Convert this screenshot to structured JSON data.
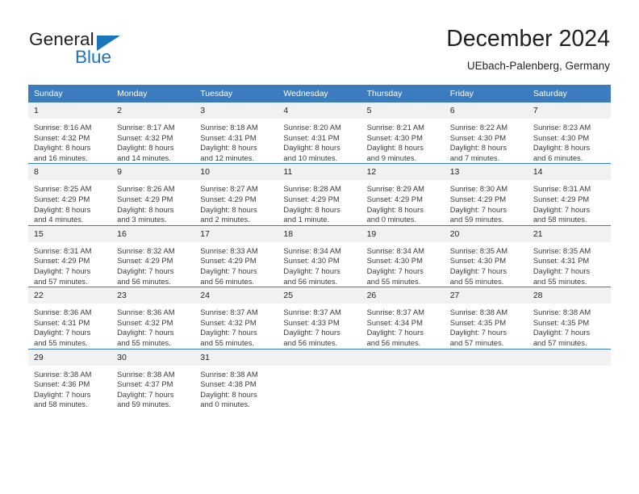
{
  "branding": {
    "name_part1": "General",
    "name_part2": "Blue",
    "primary_color": "#1b75bb",
    "header_color": "#3a7cbe"
  },
  "header": {
    "title": "December 2024",
    "subtitle": "UEbach-Palenberg, Germany"
  },
  "weekday_headers": [
    "Sunday",
    "Monday",
    "Tuesday",
    "Wednesday",
    "Thursday",
    "Friday",
    "Saturday"
  ],
  "labels": {
    "sunrise_prefix": "Sunrise:",
    "sunset_prefix": "Sunset:",
    "daylight_prefix": "Daylight:"
  },
  "weeks": [
    [
      {
        "day": "1",
        "sunrise": "Sunrise: 8:16 AM",
        "sunset": "Sunset: 4:32 PM",
        "daylight_line1": "Daylight: 8 hours",
        "daylight_line2": "and 16 minutes."
      },
      {
        "day": "2",
        "sunrise": "Sunrise: 8:17 AM",
        "sunset": "Sunset: 4:32 PM",
        "daylight_line1": "Daylight: 8 hours",
        "daylight_line2": "and 14 minutes."
      },
      {
        "day": "3",
        "sunrise": "Sunrise: 8:18 AM",
        "sunset": "Sunset: 4:31 PM",
        "daylight_line1": "Daylight: 8 hours",
        "daylight_line2": "and 12 minutes."
      },
      {
        "day": "4",
        "sunrise": "Sunrise: 8:20 AM",
        "sunset": "Sunset: 4:31 PM",
        "daylight_line1": "Daylight: 8 hours",
        "daylight_line2": "and 10 minutes."
      },
      {
        "day": "5",
        "sunrise": "Sunrise: 8:21 AM",
        "sunset": "Sunset: 4:30 PM",
        "daylight_line1": "Daylight: 8 hours",
        "daylight_line2": "and 9 minutes."
      },
      {
        "day": "6",
        "sunrise": "Sunrise: 8:22 AM",
        "sunset": "Sunset: 4:30 PM",
        "daylight_line1": "Daylight: 8 hours",
        "daylight_line2": "and 7 minutes."
      },
      {
        "day": "7",
        "sunrise": "Sunrise: 8:23 AM",
        "sunset": "Sunset: 4:30 PM",
        "daylight_line1": "Daylight: 8 hours",
        "daylight_line2": "and 6 minutes."
      }
    ],
    [
      {
        "day": "8",
        "sunrise": "Sunrise: 8:25 AM",
        "sunset": "Sunset: 4:29 PM",
        "daylight_line1": "Daylight: 8 hours",
        "daylight_line2": "and 4 minutes."
      },
      {
        "day": "9",
        "sunrise": "Sunrise: 8:26 AM",
        "sunset": "Sunset: 4:29 PM",
        "daylight_line1": "Daylight: 8 hours",
        "daylight_line2": "and 3 minutes."
      },
      {
        "day": "10",
        "sunrise": "Sunrise: 8:27 AM",
        "sunset": "Sunset: 4:29 PM",
        "daylight_line1": "Daylight: 8 hours",
        "daylight_line2": "and 2 minutes."
      },
      {
        "day": "11",
        "sunrise": "Sunrise: 8:28 AM",
        "sunset": "Sunset: 4:29 PM",
        "daylight_line1": "Daylight: 8 hours",
        "daylight_line2": "and 1 minute."
      },
      {
        "day": "12",
        "sunrise": "Sunrise: 8:29 AM",
        "sunset": "Sunset: 4:29 PM",
        "daylight_line1": "Daylight: 8 hours",
        "daylight_line2": "and 0 minutes."
      },
      {
        "day": "13",
        "sunrise": "Sunrise: 8:30 AM",
        "sunset": "Sunset: 4:29 PM",
        "daylight_line1": "Daylight: 7 hours",
        "daylight_line2": "and 59 minutes."
      },
      {
        "day": "14",
        "sunrise": "Sunrise: 8:31 AM",
        "sunset": "Sunset: 4:29 PM",
        "daylight_line1": "Daylight: 7 hours",
        "daylight_line2": "and 58 minutes."
      }
    ],
    [
      {
        "day": "15",
        "sunrise": "Sunrise: 8:31 AM",
        "sunset": "Sunset: 4:29 PM",
        "daylight_line1": "Daylight: 7 hours",
        "daylight_line2": "and 57 minutes."
      },
      {
        "day": "16",
        "sunrise": "Sunrise: 8:32 AM",
        "sunset": "Sunset: 4:29 PM",
        "daylight_line1": "Daylight: 7 hours",
        "daylight_line2": "and 56 minutes."
      },
      {
        "day": "17",
        "sunrise": "Sunrise: 8:33 AM",
        "sunset": "Sunset: 4:29 PM",
        "daylight_line1": "Daylight: 7 hours",
        "daylight_line2": "and 56 minutes."
      },
      {
        "day": "18",
        "sunrise": "Sunrise: 8:34 AM",
        "sunset": "Sunset: 4:30 PM",
        "daylight_line1": "Daylight: 7 hours",
        "daylight_line2": "and 56 minutes."
      },
      {
        "day": "19",
        "sunrise": "Sunrise: 8:34 AM",
        "sunset": "Sunset: 4:30 PM",
        "daylight_line1": "Daylight: 7 hours",
        "daylight_line2": "and 55 minutes."
      },
      {
        "day": "20",
        "sunrise": "Sunrise: 8:35 AM",
        "sunset": "Sunset: 4:30 PM",
        "daylight_line1": "Daylight: 7 hours",
        "daylight_line2": "and 55 minutes."
      },
      {
        "day": "21",
        "sunrise": "Sunrise: 8:35 AM",
        "sunset": "Sunset: 4:31 PM",
        "daylight_line1": "Daylight: 7 hours",
        "daylight_line2": "and 55 minutes."
      }
    ],
    [
      {
        "day": "22",
        "sunrise": "Sunrise: 8:36 AM",
        "sunset": "Sunset: 4:31 PM",
        "daylight_line1": "Daylight: 7 hours",
        "daylight_line2": "and 55 minutes."
      },
      {
        "day": "23",
        "sunrise": "Sunrise: 8:36 AM",
        "sunset": "Sunset: 4:32 PM",
        "daylight_line1": "Daylight: 7 hours",
        "daylight_line2": "and 55 minutes."
      },
      {
        "day": "24",
        "sunrise": "Sunrise: 8:37 AM",
        "sunset": "Sunset: 4:32 PM",
        "daylight_line1": "Daylight: 7 hours",
        "daylight_line2": "and 55 minutes."
      },
      {
        "day": "25",
        "sunrise": "Sunrise: 8:37 AM",
        "sunset": "Sunset: 4:33 PM",
        "daylight_line1": "Daylight: 7 hours",
        "daylight_line2": "and 56 minutes."
      },
      {
        "day": "26",
        "sunrise": "Sunrise: 8:37 AM",
        "sunset": "Sunset: 4:34 PM",
        "daylight_line1": "Daylight: 7 hours",
        "daylight_line2": "and 56 minutes."
      },
      {
        "day": "27",
        "sunrise": "Sunrise: 8:38 AM",
        "sunset": "Sunset: 4:35 PM",
        "daylight_line1": "Daylight: 7 hours",
        "daylight_line2": "and 57 minutes."
      },
      {
        "day": "28",
        "sunrise": "Sunrise: 8:38 AM",
        "sunset": "Sunset: 4:35 PM",
        "daylight_line1": "Daylight: 7 hours",
        "daylight_line2": "and 57 minutes."
      }
    ],
    [
      {
        "day": "29",
        "sunrise": "Sunrise: 8:38 AM",
        "sunset": "Sunset: 4:36 PM",
        "daylight_line1": "Daylight: 7 hours",
        "daylight_line2": "and 58 minutes."
      },
      {
        "day": "30",
        "sunrise": "Sunrise: 8:38 AM",
        "sunset": "Sunset: 4:37 PM",
        "daylight_line1": "Daylight: 7 hours",
        "daylight_line2": "and 59 minutes."
      },
      {
        "day": "31",
        "sunrise": "Sunrise: 8:38 AM",
        "sunset": "Sunset: 4:38 PM",
        "daylight_line1": "Daylight: 8 hours",
        "daylight_line2": "and 0 minutes."
      },
      {
        "day": "",
        "sunrise": "",
        "sunset": "",
        "daylight_line1": "",
        "daylight_line2": ""
      },
      {
        "day": "",
        "sunrise": "",
        "sunset": "",
        "daylight_line1": "",
        "daylight_line2": ""
      },
      {
        "day": "",
        "sunrise": "",
        "sunset": "",
        "daylight_line1": "",
        "daylight_line2": ""
      },
      {
        "day": "",
        "sunrise": "",
        "sunset": "",
        "daylight_line1": "",
        "daylight_line2": ""
      }
    ]
  ]
}
